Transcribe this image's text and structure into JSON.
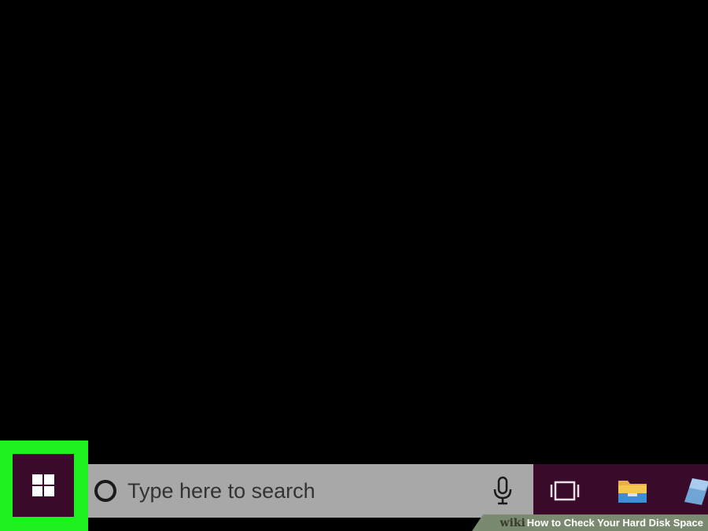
{
  "taskbar": {
    "search": {
      "placeholder": "Type here to search"
    },
    "icons": {
      "start": "windows-logo-icon",
      "cortana": "cortana-circle-icon",
      "mic": "microphone-icon",
      "taskview": "task-view-icon",
      "explorer": "file-explorer-folder-icon",
      "edge": "browser-icon"
    },
    "colors": {
      "taskbar_bg": "#3a0a2a",
      "search_bg": "#a8a8a8",
      "highlight": "#1ff01f"
    }
  },
  "watermark": {
    "brand": "wiki",
    "title": "How to Check Your Hard Disk Space"
  }
}
